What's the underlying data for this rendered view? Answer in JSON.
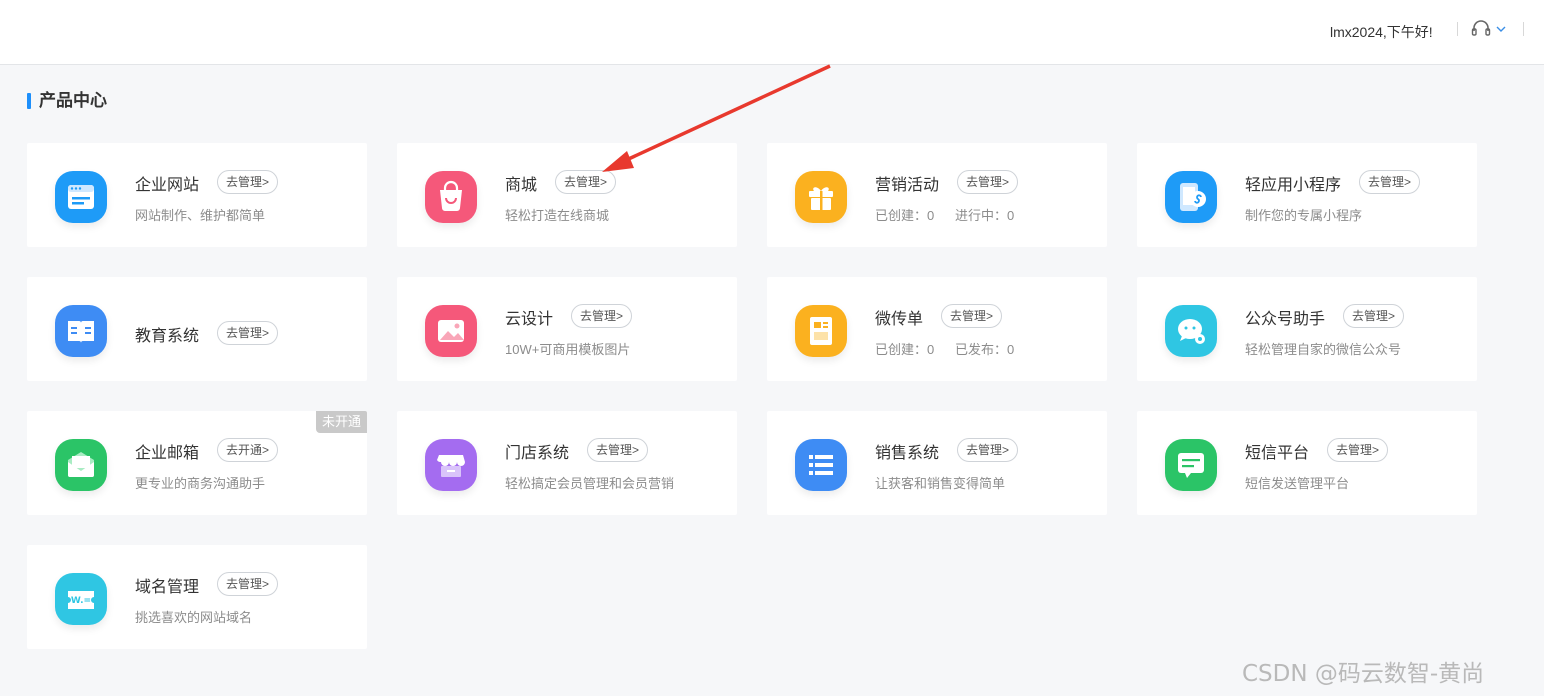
{
  "header": {
    "greeting": "lmx2024,下午好!",
    "support_icon": "headset-icon",
    "dropdown_icon": "chevron-down-icon"
  },
  "section": {
    "title": "产品中心"
  },
  "cards": [
    {
      "title": "企业网站",
      "button": "去管理>",
      "desc": "网站制作、维护都简单",
      "icon": "website-icon",
      "color": "#1e9bf7"
    },
    {
      "title": "商城",
      "button": "去管理>",
      "desc": "轻松打造在线商城",
      "icon": "shopping-bag-icon",
      "color": "#f5587a"
    },
    {
      "title": "营销活动",
      "button": "去管理>",
      "stats": [
        "已创建：0",
        "进行中：0"
      ],
      "icon": "gift-icon",
      "color": "#fbb11f"
    },
    {
      "title": "轻应用小程序",
      "button": "去管理>",
      "desc": "制作您的专属小程序",
      "icon": "mini-program-icon",
      "color": "#1e9bf7"
    },
    {
      "title": "教育系统",
      "button": "去管理>",
      "icon": "book-icon",
      "color": "#3e8cf4"
    },
    {
      "title": "云设计",
      "button": "去管理>",
      "desc": "10W+可商用模板图片",
      "icon": "image-icon",
      "color": "#f5587a"
    },
    {
      "title": "微传单",
      "button": "去管理>",
      "stats": [
        "已创建：0",
        "已发布：0"
      ],
      "icon": "flyer-icon",
      "color": "#fbb11f"
    },
    {
      "title": "公众号助手",
      "button": "去管理>",
      "desc": "轻松管理自家的微信公众号",
      "icon": "wechat-icon",
      "color": "#2fc6e3"
    },
    {
      "title": "企业邮箱",
      "button": "去开通>",
      "desc": "更专业的商务沟通助手",
      "badge": "未开通",
      "icon": "mail-icon",
      "color": "#2bc467"
    },
    {
      "title": "门店系统",
      "button": "去管理>",
      "desc": "轻松搞定会员管理和会员营销",
      "icon": "store-icon",
      "color": "#a46cf0"
    },
    {
      "title": "销售系统",
      "button": "去管理>",
      "desc": "让获客和销售变得简单",
      "icon": "list-icon",
      "color": "#3e8cf4"
    },
    {
      "title": "短信平台",
      "button": "去管理>",
      "desc": "短信发送管理平台",
      "icon": "sms-icon",
      "color": "#2bc467"
    },
    {
      "title": "域名管理",
      "button": "去管理>",
      "desc": "挑选喜欢的网站域名",
      "icon": "domain-icon",
      "color": "#2fc6e3"
    }
  ],
  "watermark": "CSDN @码云数智-黄尚"
}
